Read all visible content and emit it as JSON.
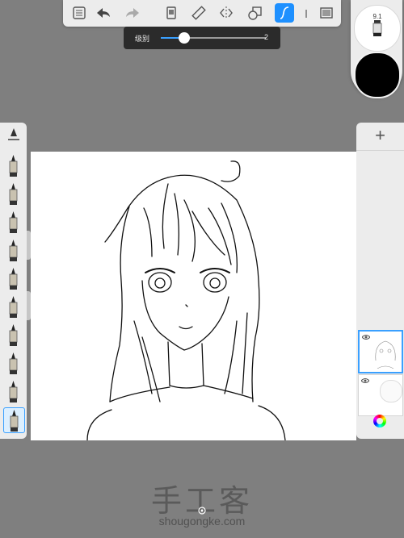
{
  "toolbar": {
    "buttons": [
      {
        "name": "list-menu-icon"
      },
      {
        "name": "undo-icon"
      },
      {
        "name": "redo-icon"
      },
      {
        "name": "brush-library-icon"
      },
      {
        "name": "ruler-icon"
      },
      {
        "name": "symmetry-icon"
      },
      {
        "name": "shapes-icon"
      },
      {
        "name": "stroke-curve-icon",
        "active": true
      },
      {
        "name": "extra-icon"
      },
      {
        "name": "fullscreen-icon"
      }
    ]
  },
  "slider": {
    "label": "级别",
    "value": "2",
    "level_fraction": 0.22
  },
  "brush_preview": {
    "size": "9.1",
    "color": "#000000"
  },
  "brushes": [
    {
      "name": "pencil-brush-icon"
    },
    {
      "name": "ballpoint-brush-icon"
    },
    {
      "name": "marker-brush-icon"
    },
    {
      "name": "fine-pen-brush-icon"
    },
    {
      "name": "paintbrush-brush-icon"
    },
    {
      "name": "airbrush-brush-icon"
    },
    {
      "name": "ink-brush-icon"
    },
    {
      "name": "smudge-brush-icon"
    },
    {
      "name": "eraser-brush-icon"
    },
    {
      "name": "fill-brush-icon",
      "active": true
    }
  ],
  "layers": {
    "add_label": "+"
  },
  "watermark": {
    "logo": "手工客",
    "url": "shougongke.com"
  },
  "colors": {
    "accent": "#3aa0ff",
    "background": "#7f7f7f",
    "panel": "#ececec"
  }
}
